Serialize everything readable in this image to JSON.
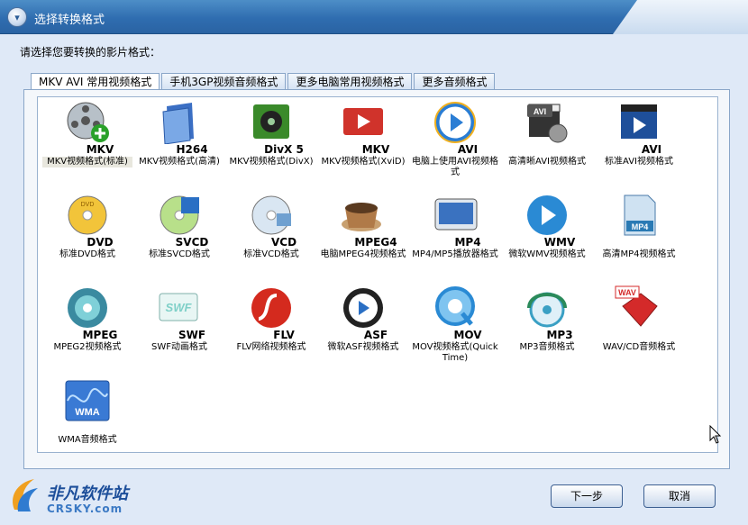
{
  "window": {
    "title": "选择转换格式"
  },
  "prompt": "请选择您要转换的影片格式：",
  "tabs": [
    {
      "label": "MKV AVI 常用视频格式"
    },
    {
      "label": "手机3GP视频音频格式"
    },
    {
      "label": "更多电脑常用视频格式"
    },
    {
      "label": "更多音频格式"
    }
  ],
  "formats": [
    {
      "label": "MKV",
      "desc": "MKV视频格式(标准)",
      "icon": "film-reel-plus-icon",
      "color": "#6f7a84"
    },
    {
      "label": "H264",
      "desc": "MKV视频格式(高清)",
      "icon": "blue-film-book-icon",
      "color": "#3b6fc4"
    },
    {
      "label": "DivX 5",
      "desc": "MKV视频格式(DivX)",
      "icon": "green-film-reel-icon",
      "color": "#3a8a2a"
    },
    {
      "label": "MKV",
      "desc": "MKV视频格式(XviD)",
      "icon": "red-play-folder-icon",
      "color": "#d0332b"
    },
    {
      "label": "AVI",
      "desc": "电脑上使用AVI视频格式",
      "icon": "blue-play-disc-icon",
      "color": "#2a7dd4"
    },
    {
      "label": "",
      "desc": "高清晰AVI视频格式",
      "icon": "clapper-reel-icon",
      "color": "#444444"
    },
    {
      "label": "AVI",
      "desc": "标准AVI视频格式",
      "icon": "clapper-play-icon",
      "color": "#2a6fc4"
    },
    {
      "label": "DVD",
      "desc": "标准DVD格式",
      "icon": "gold-dvd-disc-icon",
      "color": "#e0b020"
    },
    {
      "label": "SVCD",
      "desc": "标准SVCD格式",
      "icon": "green-disc-film-icon",
      "color": "#6fbf3a"
    },
    {
      "label": "VCD",
      "desc": "标准VCD格式",
      "icon": "silver-disc-film-icon",
      "color": "#a9c3da"
    },
    {
      "label": "MPEG4",
      "desc": "电脑MPEG4视频格式",
      "icon": "coffee-cup-icon",
      "color": "#b38a5a"
    },
    {
      "label": "MP4",
      "desc": "MP4/MP5播放器格式",
      "icon": "media-player-device-icon",
      "color": "#3a72c0"
    },
    {
      "label": "WMV",
      "desc": "微软WMV视频格式",
      "icon": "blue-play-circle-icon",
      "color": "#2a8ad4"
    },
    {
      "label": "",
      "desc": "高清MP4视频格式",
      "icon": "mp4-document-icon",
      "color": "#2a7ab4"
    },
    {
      "label": "MPEG",
      "desc": "MPEG2视频格式",
      "icon": "teal-disc-icon",
      "color": "#3aa0a8"
    },
    {
      "label": "SWF",
      "desc": "SWF动画格式",
      "icon": "swf-flash-card-icon",
      "color": "#7fd0c8"
    },
    {
      "label": "FLV",
      "desc": "FLV网络视频格式",
      "icon": "flash-player-icon",
      "color": "#d42a1e"
    },
    {
      "label": "ASF",
      "desc": "微软ASF视频格式",
      "icon": "black-play-circle-icon",
      "color": "#222222"
    },
    {
      "label": "MOV",
      "desc": "MOV视频格式(QuickTime)",
      "icon": "quicktime-icon",
      "color": "#2a8ad4"
    },
    {
      "label": "MP3",
      "desc": "MP3音频格式",
      "icon": "mp3-headphone-disc-icon",
      "color": "#3aa0c4"
    },
    {
      "label": "",
      "desc": "WAV/CD音频格式",
      "icon": "wav-speaker-icon",
      "color": "#d42a2a"
    },
    {
      "label": "",
      "desc": "WMA音频格式",
      "icon": "wma-wave-icon",
      "color": "#2a6fc4"
    }
  ],
  "icon_text": {
    "avi_badge": "AVI",
    "mp4_badge": "MP4",
    "wav_badge": "WAV",
    "wma_badge": "WMA",
    "swf_badge": "SWF"
  },
  "buttons": {
    "next": "下一步",
    "cancel": "取消"
  },
  "logo": {
    "cn": "非凡软件站",
    "en": "CRSKY.com"
  }
}
